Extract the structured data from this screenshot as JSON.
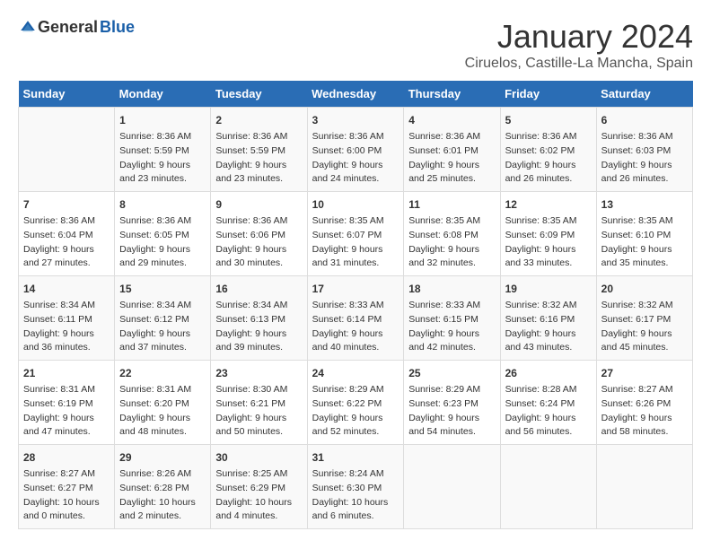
{
  "header": {
    "logo_general": "General",
    "logo_blue": "Blue",
    "month_year": "January 2024",
    "location": "Ciruelos, Castille-La Mancha, Spain"
  },
  "calendar": {
    "days_of_week": [
      "Sunday",
      "Monday",
      "Tuesday",
      "Wednesday",
      "Thursday",
      "Friday",
      "Saturday"
    ],
    "weeks": [
      [
        {
          "day": "",
          "sunrise": "",
          "sunset": "",
          "daylight": ""
        },
        {
          "day": "1",
          "sunrise": "Sunrise: 8:36 AM",
          "sunset": "Sunset: 5:59 PM",
          "daylight": "Daylight: 9 hours and 23 minutes."
        },
        {
          "day": "2",
          "sunrise": "Sunrise: 8:36 AM",
          "sunset": "Sunset: 5:59 PM",
          "daylight": "Daylight: 9 hours and 23 minutes."
        },
        {
          "day": "3",
          "sunrise": "Sunrise: 8:36 AM",
          "sunset": "Sunset: 6:00 PM",
          "daylight": "Daylight: 9 hours and 24 minutes."
        },
        {
          "day": "4",
          "sunrise": "Sunrise: 8:36 AM",
          "sunset": "Sunset: 6:01 PM",
          "daylight": "Daylight: 9 hours and 25 minutes."
        },
        {
          "day": "5",
          "sunrise": "Sunrise: 8:36 AM",
          "sunset": "Sunset: 6:02 PM",
          "daylight": "Daylight: 9 hours and 26 minutes."
        },
        {
          "day": "6",
          "sunrise": "Sunrise: 8:36 AM",
          "sunset": "Sunset: 6:03 PM",
          "daylight": "Daylight: 9 hours and 26 minutes."
        }
      ],
      [
        {
          "day": "7",
          "sunrise": "Sunrise: 8:36 AM",
          "sunset": "Sunset: 6:04 PM",
          "daylight": "Daylight: 9 hours and 27 minutes."
        },
        {
          "day": "8",
          "sunrise": "Sunrise: 8:36 AM",
          "sunset": "Sunset: 6:05 PM",
          "daylight": "Daylight: 9 hours and 29 minutes."
        },
        {
          "day": "9",
          "sunrise": "Sunrise: 8:36 AM",
          "sunset": "Sunset: 6:06 PM",
          "daylight": "Daylight: 9 hours and 30 minutes."
        },
        {
          "day": "10",
          "sunrise": "Sunrise: 8:35 AM",
          "sunset": "Sunset: 6:07 PM",
          "daylight": "Daylight: 9 hours and 31 minutes."
        },
        {
          "day": "11",
          "sunrise": "Sunrise: 8:35 AM",
          "sunset": "Sunset: 6:08 PM",
          "daylight": "Daylight: 9 hours and 32 minutes."
        },
        {
          "day": "12",
          "sunrise": "Sunrise: 8:35 AM",
          "sunset": "Sunset: 6:09 PM",
          "daylight": "Daylight: 9 hours and 33 minutes."
        },
        {
          "day": "13",
          "sunrise": "Sunrise: 8:35 AM",
          "sunset": "Sunset: 6:10 PM",
          "daylight": "Daylight: 9 hours and 35 minutes."
        }
      ],
      [
        {
          "day": "14",
          "sunrise": "Sunrise: 8:34 AM",
          "sunset": "Sunset: 6:11 PM",
          "daylight": "Daylight: 9 hours and 36 minutes."
        },
        {
          "day": "15",
          "sunrise": "Sunrise: 8:34 AM",
          "sunset": "Sunset: 6:12 PM",
          "daylight": "Daylight: 9 hours and 37 minutes."
        },
        {
          "day": "16",
          "sunrise": "Sunrise: 8:34 AM",
          "sunset": "Sunset: 6:13 PM",
          "daylight": "Daylight: 9 hours and 39 minutes."
        },
        {
          "day": "17",
          "sunrise": "Sunrise: 8:33 AM",
          "sunset": "Sunset: 6:14 PM",
          "daylight": "Daylight: 9 hours and 40 minutes."
        },
        {
          "day": "18",
          "sunrise": "Sunrise: 8:33 AM",
          "sunset": "Sunset: 6:15 PM",
          "daylight": "Daylight: 9 hours and 42 minutes."
        },
        {
          "day": "19",
          "sunrise": "Sunrise: 8:32 AM",
          "sunset": "Sunset: 6:16 PM",
          "daylight": "Daylight: 9 hours and 43 minutes."
        },
        {
          "day": "20",
          "sunrise": "Sunrise: 8:32 AM",
          "sunset": "Sunset: 6:17 PM",
          "daylight": "Daylight: 9 hours and 45 minutes."
        }
      ],
      [
        {
          "day": "21",
          "sunrise": "Sunrise: 8:31 AM",
          "sunset": "Sunset: 6:19 PM",
          "daylight": "Daylight: 9 hours and 47 minutes."
        },
        {
          "day": "22",
          "sunrise": "Sunrise: 8:31 AM",
          "sunset": "Sunset: 6:20 PM",
          "daylight": "Daylight: 9 hours and 48 minutes."
        },
        {
          "day": "23",
          "sunrise": "Sunrise: 8:30 AM",
          "sunset": "Sunset: 6:21 PM",
          "daylight": "Daylight: 9 hours and 50 minutes."
        },
        {
          "day": "24",
          "sunrise": "Sunrise: 8:29 AM",
          "sunset": "Sunset: 6:22 PM",
          "daylight": "Daylight: 9 hours and 52 minutes."
        },
        {
          "day": "25",
          "sunrise": "Sunrise: 8:29 AM",
          "sunset": "Sunset: 6:23 PM",
          "daylight": "Daylight: 9 hours and 54 minutes."
        },
        {
          "day": "26",
          "sunrise": "Sunrise: 8:28 AM",
          "sunset": "Sunset: 6:24 PM",
          "daylight": "Daylight: 9 hours and 56 minutes."
        },
        {
          "day": "27",
          "sunrise": "Sunrise: 8:27 AM",
          "sunset": "Sunset: 6:26 PM",
          "daylight": "Daylight: 9 hours and 58 minutes."
        }
      ],
      [
        {
          "day": "28",
          "sunrise": "Sunrise: 8:27 AM",
          "sunset": "Sunset: 6:27 PM",
          "daylight": "Daylight: 10 hours and 0 minutes."
        },
        {
          "day": "29",
          "sunrise": "Sunrise: 8:26 AM",
          "sunset": "Sunset: 6:28 PM",
          "daylight": "Daylight: 10 hours and 2 minutes."
        },
        {
          "day": "30",
          "sunrise": "Sunrise: 8:25 AM",
          "sunset": "Sunset: 6:29 PM",
          "daylight": "Daylight: 10 hours and 4 minutes."
        },
        {
          "day": "31",
          "sunrise": "Sunrise: 8:24 AM",
          "sunset": "Sunset: 6:30 PM",
          "daylight": "Daylight: 10 hours and 6 minutes."
        },
        {
          "day": "",
          "sunrise": "",
          "sunset": "",
          "daylight": ""
        },
        {
          "day": "",
          "sunrise": "",
          "sunset": "",
          "daylight": ""
        },
        {
          "day": "",
          "sunrise": "",
          "sunset": "",
          "daylight": ""
        }
      ]
    ]
  }
}
